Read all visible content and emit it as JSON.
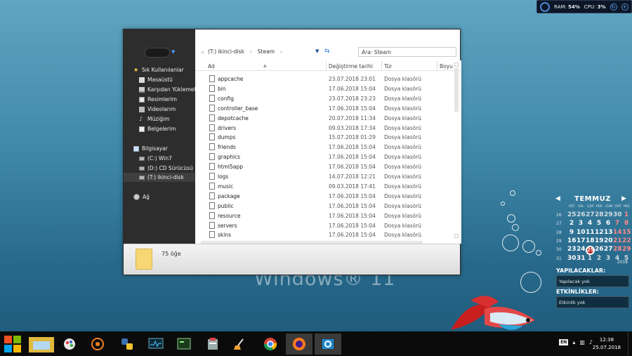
{
  "desktop": {
    "watermark": "Windows® 11"
  },
  "sysmon": {
    "ram_label": "RAM:",
    "ram_value": "54%",
    "cpu_label": "CPU:",
    "cpu_value": "3%"
  },
  "explorer": {
    "sidebar": {
      "items": [
        {
          "label": "Sık Kullanılanlar",
          "icon": "star-icon"
        },
        {
          "label": "Masaüstü",
          "icon": "desktop-icon"
        },
        {
          "label": "Karşıdan Yüklemeler",
          "icon": "downloads-icon"
        },
        {
          "label": "Resimlerim",
          "icon": "pictures-icon"
        },
        {
          "label": "Videolarım",
          "icon": "videos-icon"
        },
        {
          "label": "Müziğim",
          "icon": "music-icon"
        },
        {
          "label": "Belgelerim",
          "icon": "documents-icon"
        },
        {
          "label": "Bilgisayar",
          "icon": "computer-icon"
        },
        {
          "label": "(C:) Win7",
          "icon": "drive-icon"
        },
        {
          "label": "(D:) CD Sürücüsü",
          "icon": "drive-icon"
        },
        {
          "label": "(T:) ikinci-disk",
          "icon": "drive-icon"
        },
        {
          "label": "Ağ",
          "icon": "network-icon"
        }
      ]
    },
    "breadcrumb": {
      "back": "«",
      "items": [
        "(T:) ikinci-disk",
        "Steam"
      ],
      "sep": "›"
    },
    "search_placeholder": "Ara: Steam",
    "columns": {
      "name": "Ad",
      "date": "Değiştirme tarihi",
      "type": "Tür",
      "size": "Boyu"
    },
    "files": [
      {
        "name": "appcache",
        "date": "23.07.2018 23:01",
        "type": "Dosya klasörü"
      },
      {
        "name": "bin",
        "date": "17.06.2018 15:04",
        "type": "Dosya klasörü"
      },
      {
        "name": "config",
        "date": "23.07.2018 23:23",
        "type": "Dosya klasörü"
      },
      {
        "name": "controller_base",
        "date": "17.06.2018 15:04",
        "type": "Dosya klasörü"
      },
      {
        "name": "depotcache",
        "date": "20.07.2018 11:34",
        "type": "Dosya klasörü"
      },
      {
        "name": "drivers",
        "date": "09.03.2018 17:34",
        "type": "Dosya klasörü"
      },
      {
        "name": "dumps",
        "date": "15.07.2018 01:29",
        "type": "Dosya klasörü"
      },
      {
        "name": "friends",
        "date": "17.06.2018 15:04",
        "type": "Dosya klasörü"
      },
      {
        "name": "graphics",
        "date": "17.06.2018 15:04",
        "type": "Dosya klasörü"
      },
      {
        "name": "html5app",
        "date": "17.06.2018 15:04",
        "type": "Dosya klasörü"
      },
      {
        "name": "logs",
        "date": "14.07.2018 12:21",
        "type": "Dosya klasörü"
      },
      {
        "name": "music",
        "date": "09.03.2018 17:41",
        "type": "Dosya klasörü"
      },
      {
        "name": "package",
        "date": "17.06.2018 15:04",
        "type": "Dosya klasörü"
      },
      {
        "name": "public",
        "date": "17.06.2018 15:04",
        "type": "Dosya klasörü"
      },
      {
        "name": "resource",
        "date": "17.06.2018 15:04",
        "type": "Dosya klasörü"
      },
      {
        "name": "servers",
        "date": "17.06.2018 15:04",
        "type": "Dosya klasörü"
      },
      {
        "name": "skins",
        "date": "17.06.2018 15:04",
        "type": "Dosya klasörü"
      }
    ],
    "status": {
      "count": "75 öğe"
    }
  },
  "calendar": {
    "month": "TEMMUZ",
    "year": "2018",
    "weekdays": [
      "PZT",
      "SAL",
      "ÇAR",
      "PER",
      "CUM",
      "CMT",
      "PAZ"
    ],
    "weeks": [
      {
        "wk": "26",
        "days": [
          "25",
          "26",
          "27",
          "28",
          "29",
          "30",
          "1"
        ]
      },
      {
        "wk": "27",
        "days": [
          "2",
          "3",
          "4",
          "5",
          "6",
          "7",
          "8"
        ]
      },
      {
        "wk": "28",
        "days": [
          "9",
          "10",
          "11",
          "12",
          "13",
          "14",
          "15"
        ]
      },
      {
        "wk": "29",
        "days": [
          "16",
          "17",
          "18",
          "19",
          "20",
          "21",
          "22"
        ]
      },
      {
        "wk": "30",
        "days": [
          "23",
          "24",
          "25",
          "26",
          "27",
          "28",
          "29"
        ]
      },
      {
        "wk": "31",
        "days": [
          "30",
          "31",
          "1",
          "2",
          "3",
          "4",
          "5"
        ]
      }
    ],
    "today": "25"
  },
  "todo": {
    "title": "YAPILACAKLAR:",
    "text": "Yapılacak yok"
  },
  "events": {
    "title": "ETKİNLİKLER:",
    "text": "Etkinlik yok"
  },
  "taskbar": {
    "apps": [
      "file-explorer-icon",
      "paint-icon",
      "media-player-icon",
      "python-icon",
      "task-monitor-icon",
      "terminal-icon",
      "installer-icon",
      "cleaner-brush-icon",
      "chrome-icon",
      "firefox-icon",
      "settings-icon"
    ],
    "tray_lang": "EN",
    "time": "12:38",
    "date": "25.07.2018"
  }
}
